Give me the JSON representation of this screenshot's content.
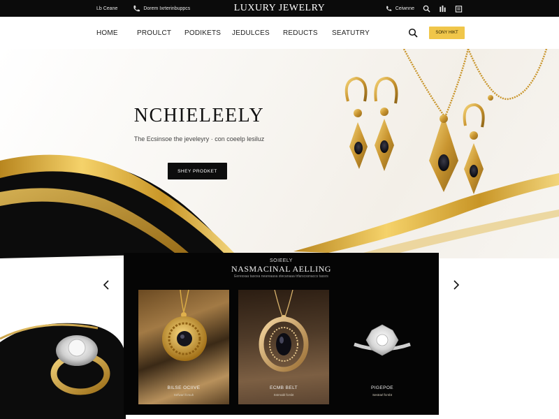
{
  "topbar": {
    "left_items": [
      "Lb Ceane",
      "Dorem Ixrterinbuppcs"
    ],
    "brand": "LUXURY JEWELRY",
    "phone": "Ceiwnne"
  },
  "nav": {
    "links": [
      "HOME",
      "PROULCT",
      "PODIKETS",
      "JEDULCES",
      "REDUCTS",
      "SEATUTRY"
    ],
    "cta_label": "SONY HIKT"
  },
  "hero": {
    "title": "NCHIELEELY",
    "subtitle": "The Ecsinsoe the jeveleyry · con coeelp lesiluz",
    "button_label": "SHEY PRODKET"
  },
  "collection": {
    "kicker": "SOIEELY",
    "title": "NASMACINAL AELLING",
    "description": "Eeresxaa tasoxa neareaasa stecanaaa trfarscssnaccs tassrs",
    "cards": [
      {
        "name": "BILSE OCIIVE",
        "price": "Sefwarl fcrsuh"
      },
      {
        "name": "ECMB BELT",
        "price": "Sstrnabl fcrsbt"
      },
      {
        "name": "PIGEPOE",
        "price": "Sestrarl fcrnbt"
      }
    ]
  },
  "colors": {
    "gold": "#f0c64a",
    "black": "#0b0b0b",
    "white": "#ffffff"
  },
  "icons": [
    "phone-icon",
    "search-icon",
    "bag-icon",
    "user-icon",
    "chevron-left-icon",
    "chevron-right-icon"
  ]
}
